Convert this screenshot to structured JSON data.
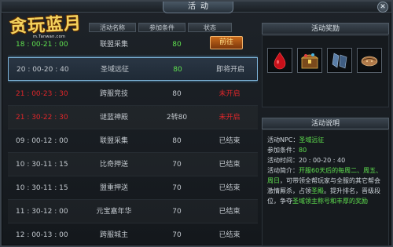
{
  "window": {
    "title": "活动",
    "close_glyph": "✕"
  },
  "logo": {
    "text": "贪玩蓝月",
    "url": "m.Tanwan.com"
  },
  "table": {
    "headers": [
      "活动名称",
      "参加条件",
      "状态"
    ],
    "rows": [
      {
        "time": "18 : 00-21 : 00",
        "name": "联盟采集",
        "cond": "80",
        "status": "前往",
        "style": "green",
        "button": true
      },
      {
        "time": "20 : 00-20 : 40",
        "name": "圣域远征",
        "cond": "80",
        "status": "即将开启",
        "style": "selected"
      },
      {
        "time": "21 : 00-23 : 30",
        "name": "跨服竞技",
        "cond": "80",
        "status": "未开启",
        "style": "red"
      },
      {
        "time": "21 : 30-22 : 30",
        "name": "谜蓝神殿",
        "cond": "2转80",
        "status": "未开启",
        "style": "red"
      },
      {
        "time": "09 : 00-12 : 00",
        "name": "联盟采集",
        "cond": "80",
        "status": "已结束",
        "style": "gray"
      },
      {
        "time": "10 : 30-11 : 15",
        "name": "比奇押送",
        "cond": "70",
        "status": "已结束",
        "style": "gray"
      },
      {
        "time": "10 : 30-11 : 15",
        "name": "盟重押送",
        "cond": "70",
        "status": "已结束",
        "style": "gray"
      },
      {
        "time": "11 : 30-12 : 00",
        "name": "元宝嘉年华",
        "cond": "70",
        "status": "已结束",
        "style": "gray"
      },
      {
        "time": "12 : 00-13 : 00",
        "name": "跨服城主",
        "cond": "70",
        "status": "已结束",
        "style": "gray"
      }
    ]
  },
  "rewards": {
    "title": "活动奖励",
    "items": [
      {
        "icon": "red-gem-icon",
        "color": "#c8101a"
      },
      {
        "icon": "treasure-chest-icon",
        "color": "#c98a2a"
      },
      {
        "icon": "blue-armor-icon",
        "color": "#5a7ea8"
      },
      {
        "icon": "horn-pouch-icon",
        "color": "#b07a4a"
      }
    ]
  },
  "description": {
    "title": "活动说明",
    "npc_label": "活动NPC：",
    "npc_value": "圣域远征",
    "cond_label": "参加条件：",
    "cond_value": "80",
    "time_label": "活动时间：",
    "time_value": "20 : 00-20 : 40",
    "intro_label": "活动简介：",
    "intro_p1": "开服60天后的每周二、周五、周日",
    "intro_p2": "，可带领全帮玩家与全服的其它帮会激情厮杀，占领",
    "intro_p3": "圣殿",
    "intro_p4": "。提升排名，晋级段位，争夺",
    "intro_p5": "圣域领主称号和丰厚的奖励"
  }
}
